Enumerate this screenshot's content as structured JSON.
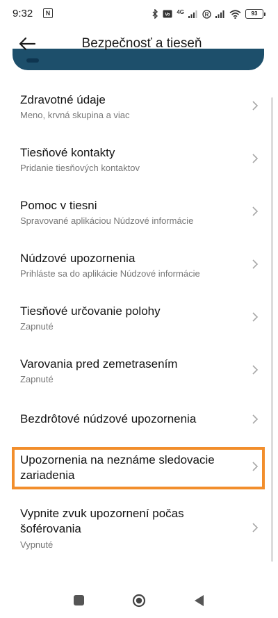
{
  "status_bar": {
    "time": "9:32",
    "n_badge": "N",
    "battery": "93",
    "network": "4G"
  },
  "header": {
    "title": "Bezpečnosť a tieseň"
  },
  "items": [
    {
      "title": "Zdravotné údaje",
      "subtitle": "Meno, krvná skupina a viac"
    },
    {
      "title": "Tiesňové kontakty",
      "subtitle": "Pridanie tiesňových kontaktov"
    },
    {
      "title": "Pomoc v tiesni",
      "subtitle": "Spravované aplikáciou Núdzové informácie"
    },
    {
      "title": "Núdzové upozornenia",
      "subtitle": "Prihláste sa do aplikácie Núdzové informácie"
    },
    {
      "title": "Tiesňové určovanie polohy",
      "subtitle": "Zapnuté"
    },
    {
      "title": "Varovania pred zemetrasením",
      "subtitle": "Zapnuté"
    },
    {
      "title": "Bezdrôtové núdzové upozornenia",
      "subtitle": ""
    },
    {
      "title": "Upozornenia na neznáme sledovacie zariadenia",
      "subtitle": ""
    },
    {
      "title": "Vypnite zvuk upozornení počas šoférovania",
      "subtitle": "Vypnuté"
    }
  ],
  "colors": {
    "highlight": "#f28e2c",
    "card": "#1d4f6b"
  },
  "icons": {
    "back": "arrow-left-icon",
    "chevron": "chevron-right-icon",
    "nav_recents": "square-icon",
    "nav_home": "circle-icon",
    "nav_back": "triangle-icon"
  }
}
